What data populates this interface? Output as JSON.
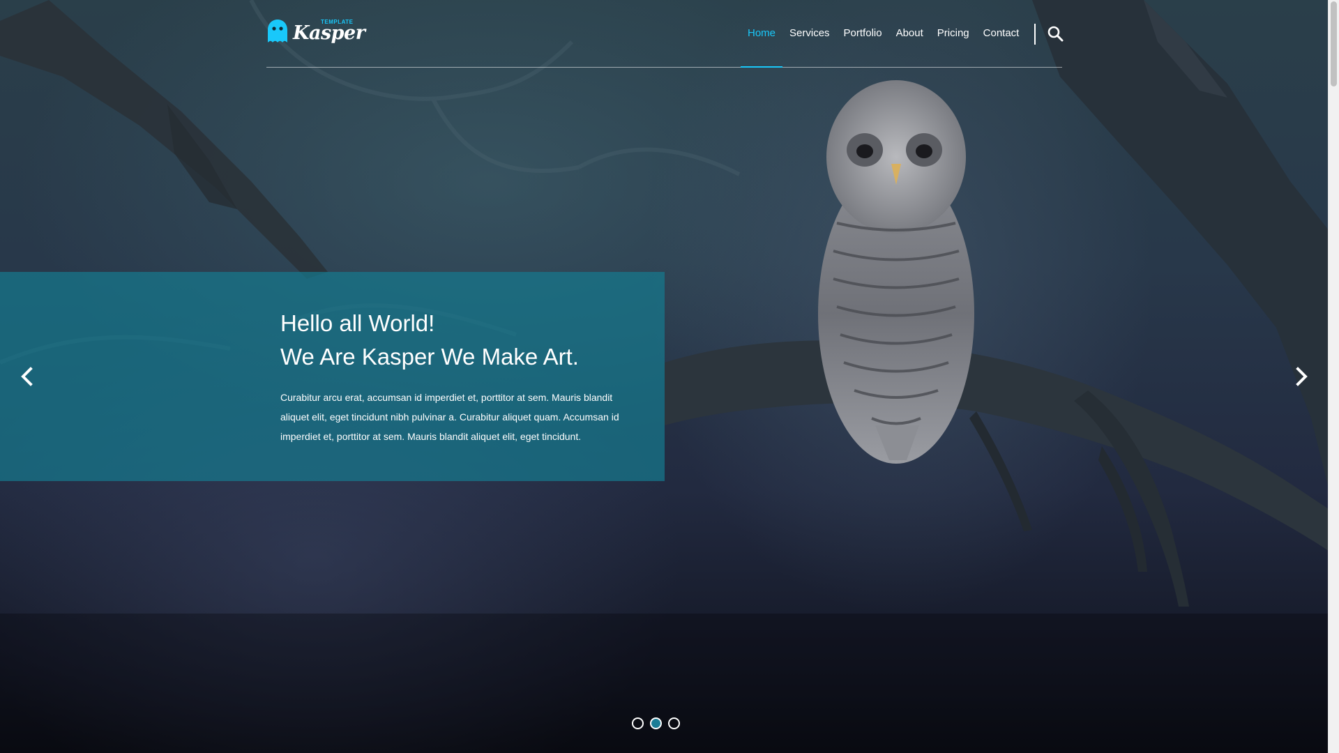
{
  "logo": {
    "name": "Kasper",
    "small_text": "TEMPLATE"
  },
  "nav": {
    "items": [
      {
        "label": "Home",
        "active": true
      },
      {
        "label": "Services",
        "active": false
      },
      {
        "label": "Portfolio",
        "active": false
      },
      {
        "label": "About",
        "active": false
      },
      {
        "label": "Pricing",
        "active": false
      },
      {
        "label": "Contact",
        "active": false
      }
    ],
    "search_icon": "search-icon"
  },
  "slide": {
    "heading_line1": "Hello all World!",
    "heading_line2": "We Are Kasper We Make Art.",
    "text": "Curabitur arcu erat, accumsan id imperdiet et, porttitor at sem. Mauris blandit aliquet elit, eget tincidunt nibh pulvinar a. Curabitur aliquet quam. Accumsan id imperdiet et, porttitor at sem. Mauris blandit aliquet elit, eget tincidunt."
  },
  "carousel": {
    "prev_icon": "chevron-left-icon",
    "next_icon": "chevron-right-icon",
    "indicator_count": 3,
    "active_index": 1
  },
  "colors": {
    "accent": "#19c8fa",
    "caption_overlay": "#16788e",
    "text": "#ffffff"
  }
}
